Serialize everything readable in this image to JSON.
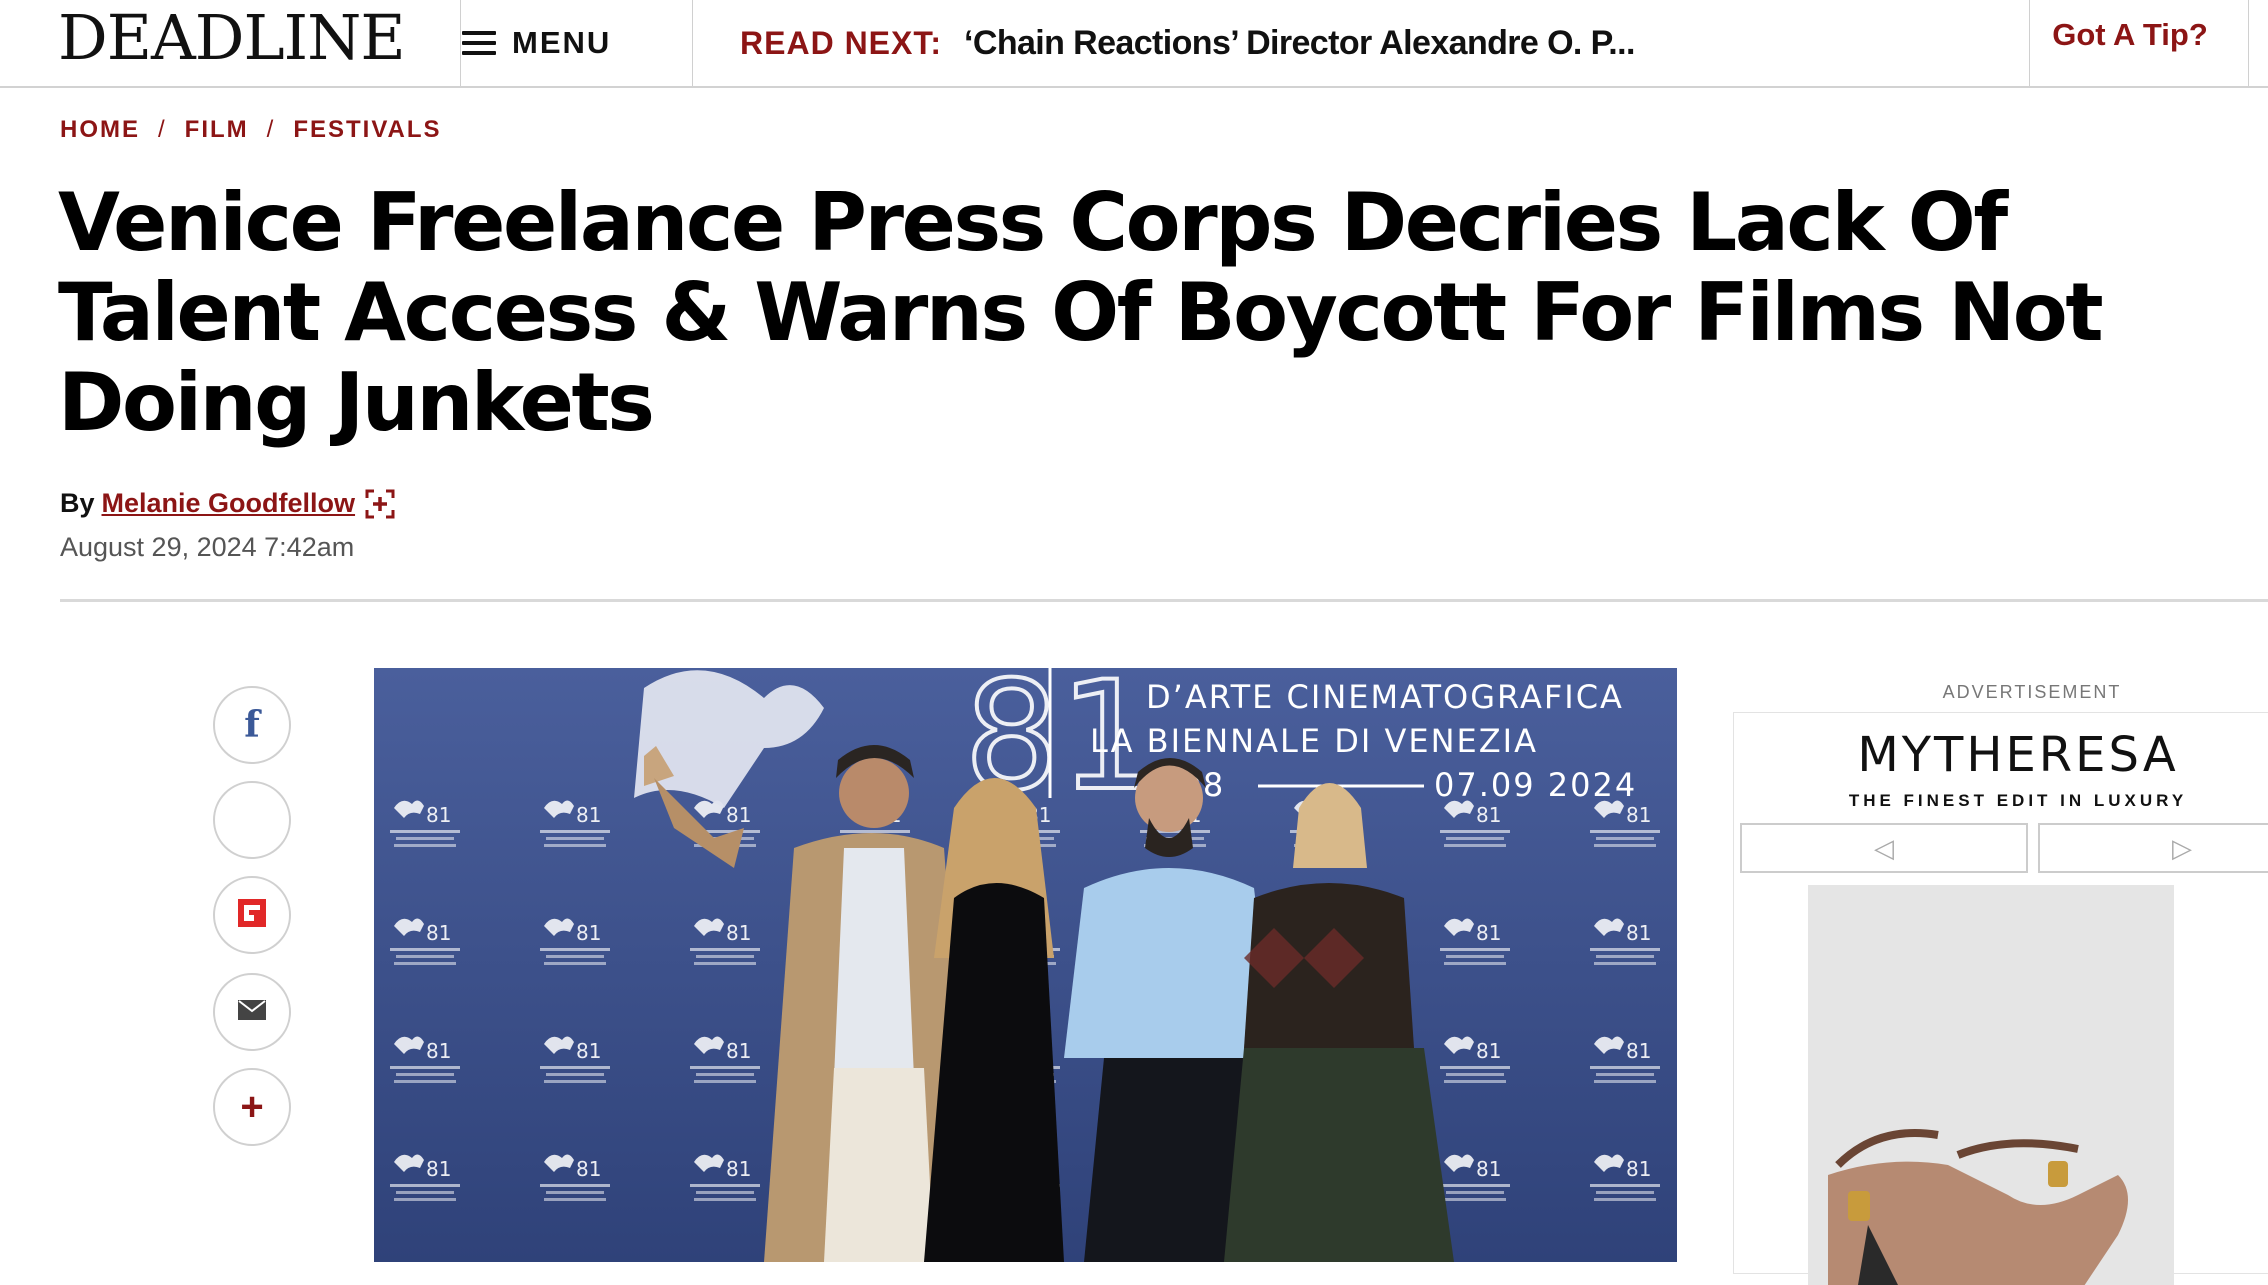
{
  "header": {
    "logo": "DEADLINE",
    "menu_label": "MENU",
    "read_next_label": "READ NEXT:",
    "read_next_title": "‘Chain Reactions’ Director Alexandre O. P...",
    "tip_label": "Got A Tip?"
  },
  "breadcrumb": {
    "items": [
      "HOME",
      "FILM",
      "FESTIVALS"
    ],
    "separator": "/"
  },
  "article": {
    "headline": "Venice Freelance Press Corps Decries Lack Of Talent Access & Warns Of Boycott For Films Not Doing Junkets",
    "by_prefix": "By",
    "author": "Melanie Goodfellow",
    "date": "August 29, 2024 7:42am"
  },
  "share": {
    "icons": [
      "facebook-icon",
      "blank-share-icon",
      "flipboard-icon",
      "email-icon",
      "plus-icon"
    ],
    "facebook_glyph": "f",
    "plus_glyph": "+"
  },
  "hero": {
    "backdrop_line1": "D’ARTE CINEMATOGRAFICA",
    "backdrop_line2": "LA BIENNALE DI VENEZIA",
    "backdrop_date_start": "2 08",
    "backdrop_date_end": "07.09 2024",
    "lion_mark": "81"
  },
  "ad": {
    "label": "ADVERTISEMENT",
    "brand": "MYTHERESA",
    "tagline": "THE FINEST EDIT IN LUXURY",
    "prev_glyph": "◁",
    "next_glyph": "▷"
  },
  "colors": {
    "accent": "#8c1515",
    "text": "#000000",
    "hero_blue": "#3b4f8d"
  }
}
